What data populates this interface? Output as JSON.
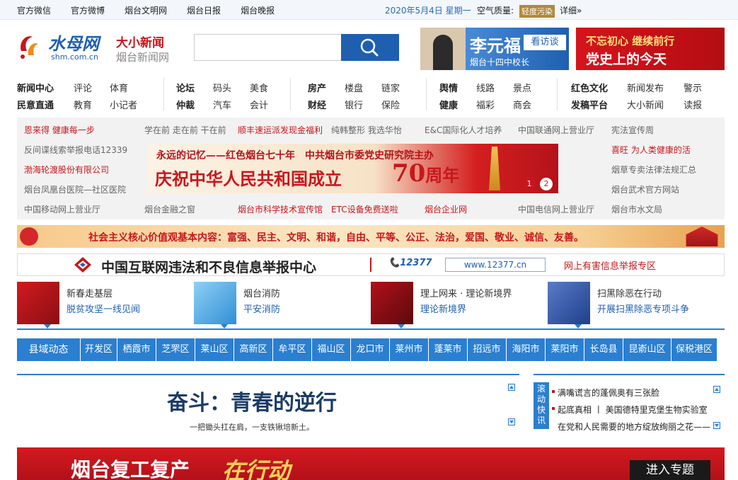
{
  "topbar": {
    "links": [
      "官方微信",
      "官方微博",
      "烟台文明网",
      "烟台日报",
      "烟台晚报"
    ],
    "date": "2020年5月4日 星期一",
    "air_label": "空气质量:",
    "air_value": "轻度污染",
    "air_detail": "详细»"
  },
  "logo": {
    "name": "水母网",
    "domain": "shm.com.cn",
    "slogan1": "大小新闻",
    "slogan2": "烟台新闻网"
  },
  "search": {
    "placeholder": ""
  },
  "banner_a": {
    "name": "李元福",
    "tag": "看访谈",
    "caption": "烟台十四中校长"
  },
  "banner_b": {
    "line1": "不忘初心 继续前行",
    "line2": "党史上的今天"
  },
  "nav": {
    "g1": [
      [
        "新闻中心",
        "评论",
        "体育"
      ],
      [
        "民意直通",
        "教育",
        "小记者"
      ]
    ],
    "g2": [
      [
        "论坛",
        "码头",
        "美食"
      ],
      [
        "仲裁",
        "汽车",
        "会计"
      ]
    ],
    "g3": [
      [
        "房产",
        "楼盘",
        "链家"
      ],
      [
        "财经",
        "银行",
        "保险"
      ]
    ],
    "g4": [
      [
        "舆情",
        "线路",
        "景点"
      ],
      [
        "健康",
        "福彩",
        "商会"
      ]
    ],
    "g5": [
      [
        "红色文化",
        "新闻发布",
        "警示"
      ],
      [
        "发稿平台",
        "大小新闻",
        "读报"
      ]
    ]
  },
  "links": {
    "r1": [
      "恩来得 健康每一步",
      "学在前 走在前 干在前",
      "顺丰速运派发现金福利",
      "纯韩整形 我选华怡",
      "E&C国际化人才培养",
      "中国联通网上营业厅",
      "宪法宣传周"
    ],
    "left": [
      "反间谍线索举报电话12339",
      "渤海轮渡股份有限公司",
      "烟台凤凰台医院—社区医院"
    ],
    "right": [
      "喜旺 为人类健康的活",
      "烟草专卖法律法规汇总",
      "烟台武术官方网站"
    ],
    "r5": [
      "中国移动网上营业厅",
      "烟台金融之窗",
      "烟台市科学技术宣传馆",
      "ETC设备免费送啦",
      "烟台企业网",
      "中国电信网上营业厅",
      "烟台市水文局"
    ]
  },
  "center_banner": {
    "subtitle": "永远的记忆——红色烟台七十年",
    "subtitle2": "中共烟台市委党史研究院主办",
    "main": "庆祝中华人民共和国成立",
    "num": "70",
    "suffix": "周年",
    "dots": [
      "1",
      "2"
    ]
  },
  "values_banner": {
    "text": "社会主义核心价值观基本内容：富强、民主、文明、和谐，自由、平等、公正、法治，爱国、敬业、诚信、友善。"
  },
  "report": {
    "title": "中国互联网违法和不良信息举报中心",
    "hotline": "12377",
    "url": "www.12377.cn",
    "zone": "网上有害信息举报专区"
  },
  "features": [
    {
      "t1": "新春走基层",
      "t2": "脱贫攻坚一线见闻"
    },
    {
      "t1": "烟台消防",
      "t2": "平安消防"
    },
    {
      "t1": "理上网来 · 理论新境界",
      "t2": "理论新境界"
    },
    {
      "t1": "扫黑除恶在行动",
      "t2": "开展扫黑除恶专项斗争"
    }
  ],
  "districts": [
    "县域动态",
    "开发区",
    "栖霞市",
    "芝罘区",
    "莱山区",
    "高新区",
    "牟平区",
    "福山区",
    "龙口市",
    "莱州市",
    "蓬莱市",
    "招远市",
    "海阳市",
    "莱阳市",
    "长岛县",
    "昆嵛山区",
    "保税港区"
  ],
  "headline": {
    "title": "奋斗：青春的逆行",
    "subtitle": "一把锄头扛在肩，一支铁锹培新土。"
  },
  "scroll": {
    "label": "滚动快讯",
    "items": [
      "满嘴谎言的蓬佩奥有三张脸",
      "起底真相 丨 美国德特里克堡生物实验室",
      "在党和人民需要的地方绽放绚丽之花——"
    ]
  },
  "bottom_banner": {
    "text": "烟台复工复产",
    "text2": "在行动",
    "enter": "进入专题"
  },
  "colors": {
    "brand_blue": "#1f5fb0",
    "accent_blue": "#2a7fd0",
    "red": "#c8161d"
  }
}
